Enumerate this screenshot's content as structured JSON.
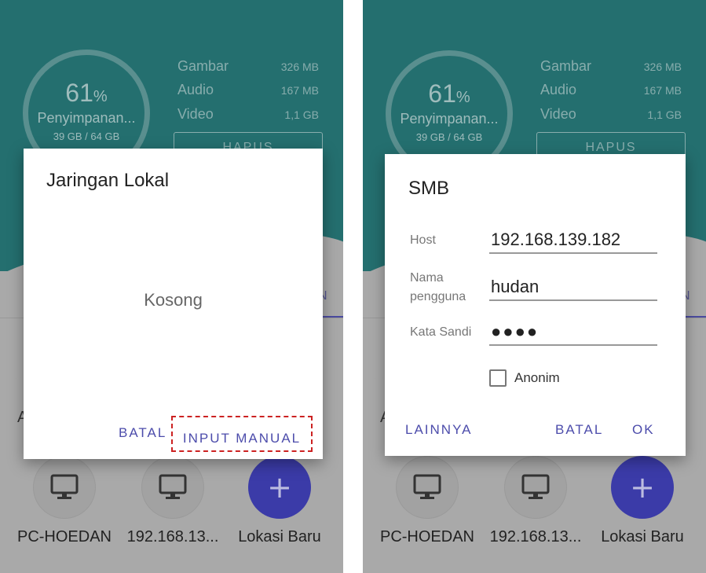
{
  "background_app": {
    "storage": {
      "percent": "61",
      "percent_sign": "%",
      "label": "Penyimpanan...",
      "usage": "39 GB / 64 GB"
    },
    "stats": [
      {
        "name": "Gambar",
        "size": "326 MB"
      },
      {
        "name": "Audio",
        "size": "167 MB"
      },
      {
        "name": "Video",
        "size": "1,1 GB"
      }
    ],
    "hapus_label": "HAPUS",
    "tab_peek": "N",
    "section_peek": "A",
    "locations": [
      {
        "label": "PC-HOEDAN",
        "icon": "monitor-icon"
      },
      {
        "label": "192.168.13...",
        "icon": "monitor-icon"
      },
      {
        "label": "Lokasi Baru",
        "icon": "plus-icon"
      }
    ]
  },
  "dialog_local": {
    "title": "Jaringan Lokal",
    "empty_text": "Kosong",
    "cancel_label": "BATAL",
    "manual_label": "INPUT MANUAL"
  },
  "dialog_smb": {
    "title": "SMB",
    "host_label": "Host",
    "host_value": "192.168.139.182",
    "user_label": "Nama pengguna",
    "user_value": "hudan",
    "pass_label": "Kata Sandi",
    "pass_value": "●●●●",
    "anon_label": "Anonim",
    "more_label": "LAINNYA",
    "cancel_label": "BATAL",
    "ok_label": "OK"
  },
  "colors": {
    "teal": "#246f6f",
    "accent": "#4c4cab",
    "highlight": "#cc2222"
  }
}
